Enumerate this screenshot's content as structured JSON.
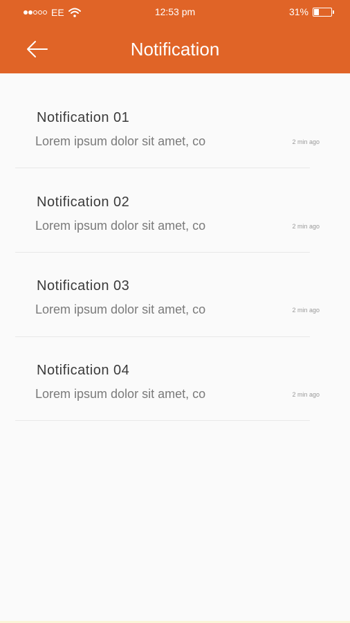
{
  "status_bar": {
    "carrier": "EE",
    "time": "12:53 pm",
    "battery": "31%",
    "battery_level": 0.31,
    "signal_bars": 2,
    "signal_total": 5
  },
  "header": {
    "title": "Notification",
    "back_icon": "arrow-left-icon",
    "color": "#e06427"
  },
  "notifications": [
    {
      "title": "Notification 01",
      "body": "Lorem ipsum dolor sit amet, co",
      "time": "2 min ago"
    },
    {
      "title": "Notification 02",
      "body": "Lorem ipsum dolor sit amet, co",
      "time": "2 min ago"
    },
    {
      "title": "Notification 03",
      "body": "Lorem ipsum dolor sit amet, co",
      "time": "2 min ago"
    },
    {
      "title": "Notification 04",
      "body": "Lorem ipsum dolor sit amet, co",
      "time": "2 min ago"
    }
  ]
}
